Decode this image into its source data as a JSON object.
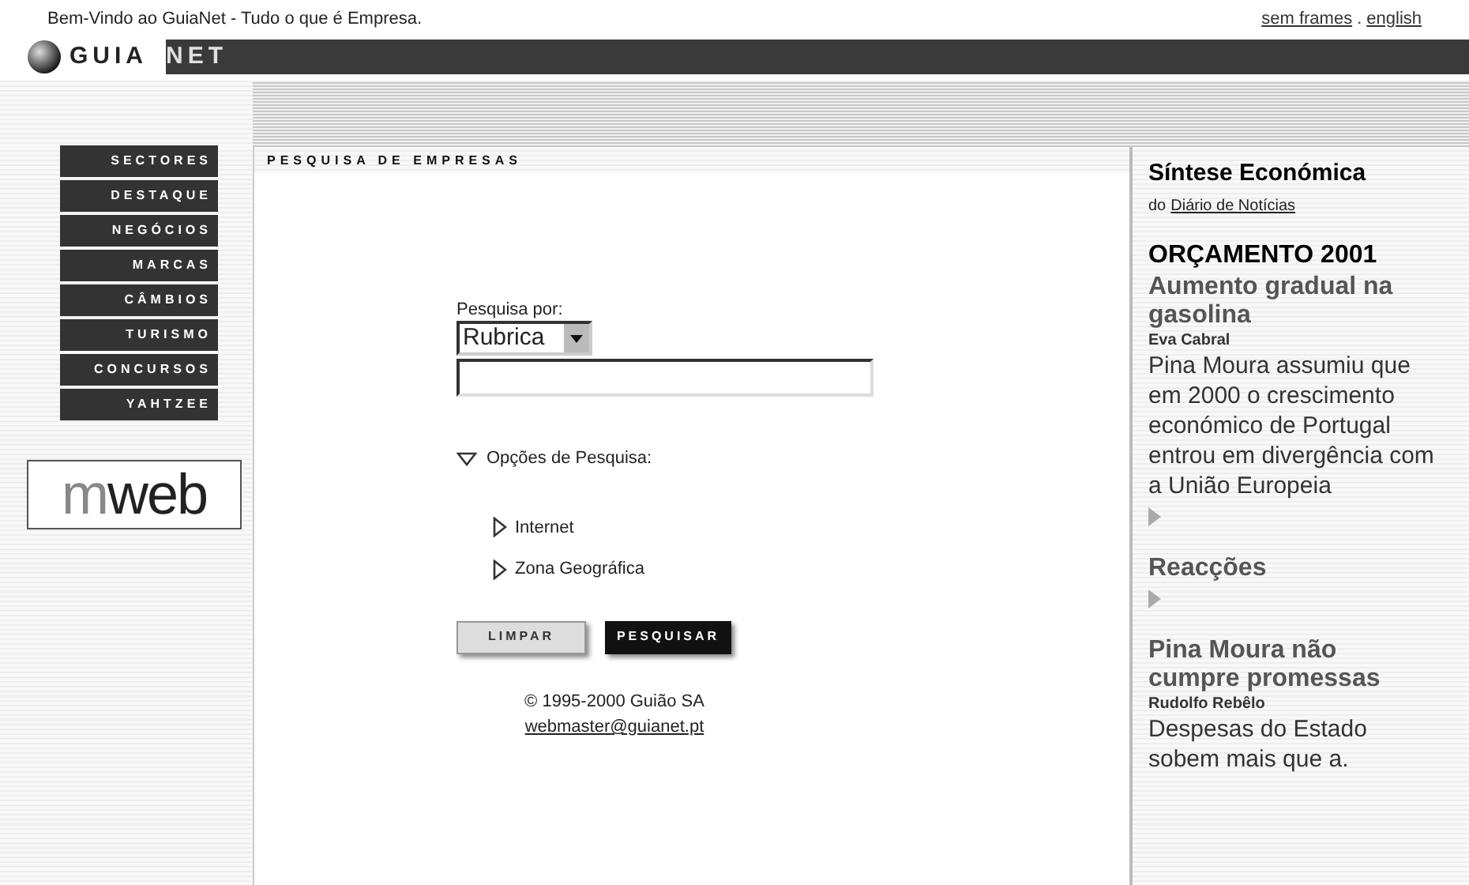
{
  "top_bar": {
    "welcome": "Bem-Vindo ao GuiaNet - Tudo o que é Empresa.",
    "links": [
      "sem frames",
      ".",
      "english"
    ]
  },
  "logo": {
    "part1": "GUIA",
    "part2": "NET"
  },
  "nav": [
    "SECTORES",
    "DESTAQUE",
    "NEGÓCIOS",
    "MARCAS",
    "CÂMBIOS",
    "TURISMO",
    "CONCURSOS",
    "YAHTZEE"
  ],
  "sponsor": {
    "part1": "m",
    "part2": "web"
  },
  "search": {
    "heading": "PESQUISA DE EMPRESAS",
    "label": "Pesquisa por:",
    "select_value": "Rubrica",
    "options": {
      "label": "Opções de Pesquisa:",
      "expanded": true,
      "children": [
        {
          "label": "Internet",
          "expanded": false
        },
        {
          "label": "Zona Geográfica",
          "expanded": false
        }
      ]
    },
    "buttons": [
      "LIMPAR",
      "PESQUISAR"
    ],
    "copyright": "© 1995-2000 Guião SA",
    "email": "webmaster@guianet.pt"
  },
  "sidebar": {
    "title": "Síntese Económica",
    "source_prefix": "do",
    "source_link": "Diário de Notícias",
    "items": [
      {
        "kind": "section",
        "text": "ORÇAMENTO 2001"
      },
      {
        "kind": "headline",
        "text": "Aumento gradual na gasolina"
      },
      {
        "kind": "author",
        "text": "Eva Cabral"
      },
      {
        "kind": "body",
        "text": "Pina Moura assumiu que em 2000 o crescimento económico de Portugal entrou em divergência com a União Europeia"
      },
      {
        "kind": "more"
      },
      {
        "kind": "headline",
        "text": "Reacções"
      },
      {
        "kind": "more"
      },
      {
        "kind": "headline",
        "text": "Pina Moura não cumpre promessas"
      },
      {
        "kind": "author",
        "text": "Rudolfo Rebêlo"
      },
      {
        "kind": "body",
        "text": "Despesas do Estado sobem mais que a."
      }
    ]
  }
}
